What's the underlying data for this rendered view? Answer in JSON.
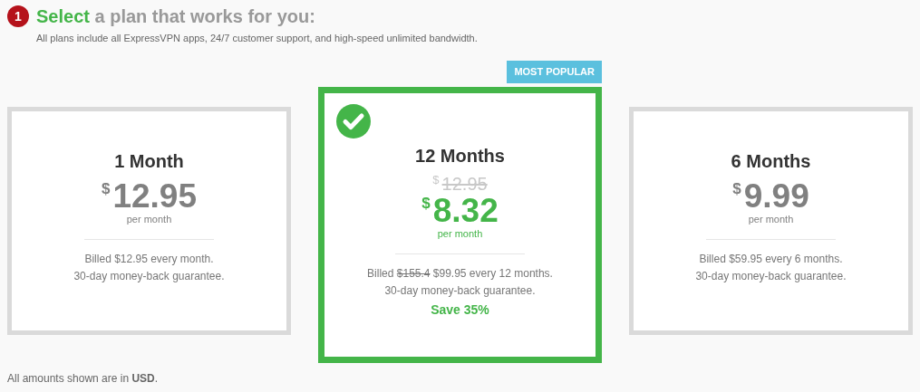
{
  "header": {
    "step": "1",
    "title_highlight": "Select",
    "title_rest": "a plan that works for you:",
    "subtitle": "All plans include all ExpressVPN apps, 24/7 customer support, and high-speed unlimited bandwidth."
  },
  "plans": [
    {
      "name": "1 Month",
      "selected": false,
      "currency": "$",
      "price": "12.95",
      "period": "per month",
      "billing": [
        {
          "text": "Billed $12.95 every month.",
          "struck": false
        }
      ],
      "guarantee": "30-day money-back guarantee."
    },
    {
      "name": "12 Months",
      "selected": true,
      "badge": "MOST POPULAR",
      "old_currency": "$",
      "old_price": "12.95",
      "currency": "$",
      "price": "8.32",
      "period": "per month",
      "billing": [
        {
          "text": "Billed",
          "struck": false
        },
        {
          "text": "$155.4",
          "struck": true
        },
        {
          "text": "$99.95 every 12 months.",
          "struck": false
        }
      ],
      "guarantee": "30-day money-back guarantee.",
      "savings": "Save 35%"
    },
    {
      "name": "6 Months",
      "selected": false,
      "currency": "$",
      "price": "9.99",
      "period": "per month",
      "billing": [
        {
          "text": "Billed $59.95 every 6 months.",
          "struck": false
        }
      ],
      "guarantee": "30-day money-back guarantee."
    }
  ],
  "footer": "All amounts shown are in **USD**."
}
